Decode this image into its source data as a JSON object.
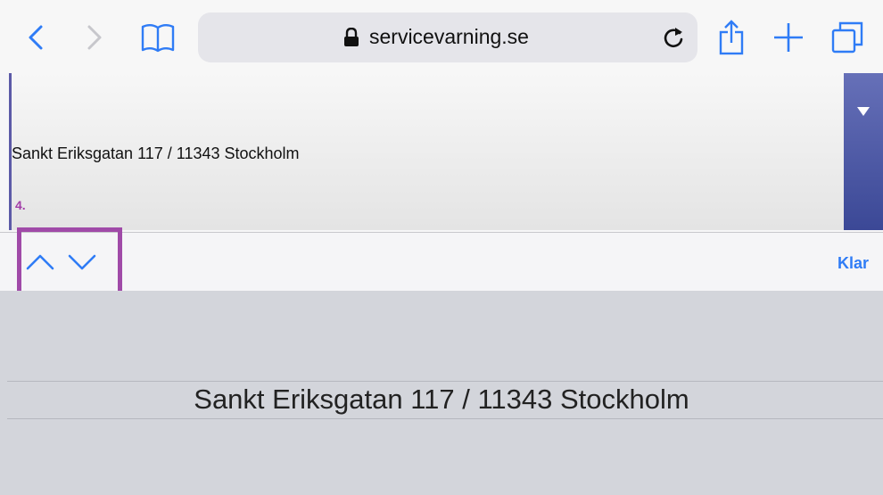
{
  "browser": {
    "url": "servicevarning.se"
  },
  "form": {
    "selected_address": "Sankt Eriksgatan 117 / 11343 Stockholm",
    "step_label": "4."
  },
  "accessory": {
    "done_label": "Klar"
  },
  "picker": {
    "selected_option": "Sankt Eriksgatan 117 / 11343 Stockholm"
  },
  "colors": {
    "accent": "#2f7cf6",
    "highlight": "#a04aa8",
    "select_button": "#3b4896"
  }
}
